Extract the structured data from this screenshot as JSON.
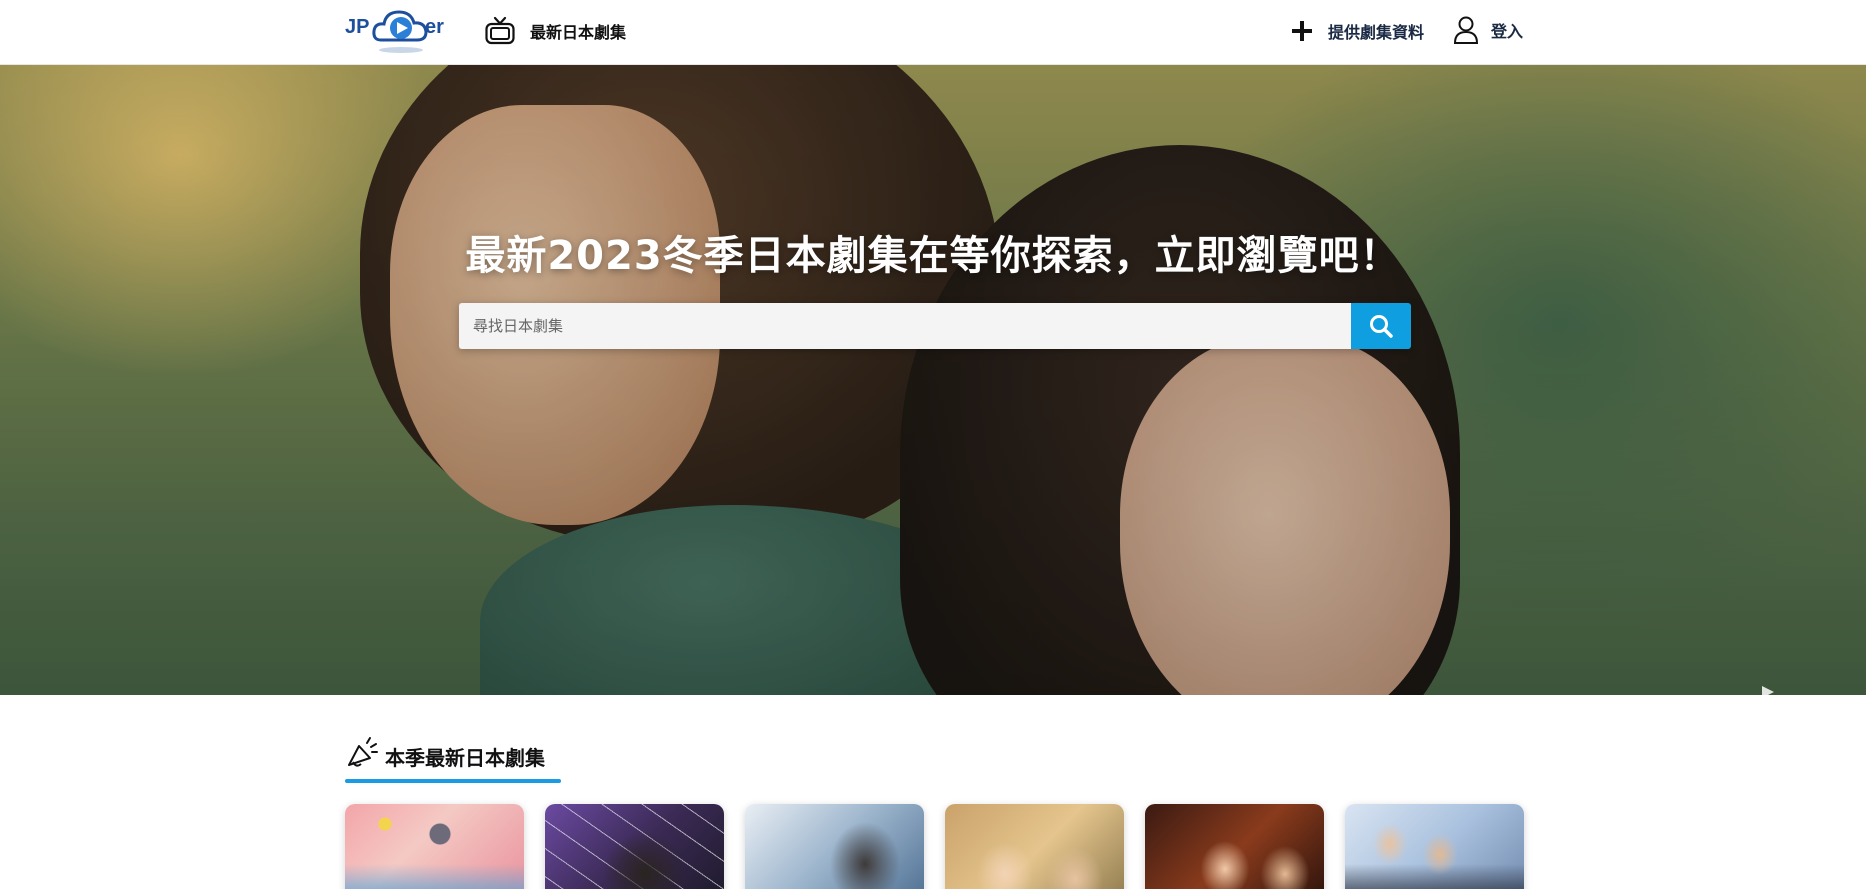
{
  "header": {
    "logo": {
      "left": "JP",
      "right": "er"
    },
    "nav_latest_label": "最新日本劇集",
    "nav_provide_label": "提供劇集資料",
    "nav_login_label": "登入"
  },
  "hero": {
    "title": "最新2023冬季日本劇集在等你探索，立即瀏覽吧！",
    "search": {
      "placeholder": "尋找日本劇集",
      "value": ""
    }
  },
  "section": {
    "title": "本季最新日本劇集",
    "accent_color": "#1a9be3"
  },
  "cards": [
    {
      "name": "drama-card-1"
    },
    {
      "name": "drama-card-2"
    },
    {
      "name": "drama-card-3"
    },
    {
      "name": "drama-card-4"
    },
    {
      "name": "drama-card-5"
    },
    {
      "name": "drama-card-6"
    }
  ],
  "colors": {
    "brand": "#1d4f9c",
    "search_button": "#0f9ee0"
  },
  "icons": [
    "tv-icon",
    "plus-icon",
    "user-icon",
    "search-icon",
    "megaphone-icon",
    "chevron-right-icon"
  ]
}
